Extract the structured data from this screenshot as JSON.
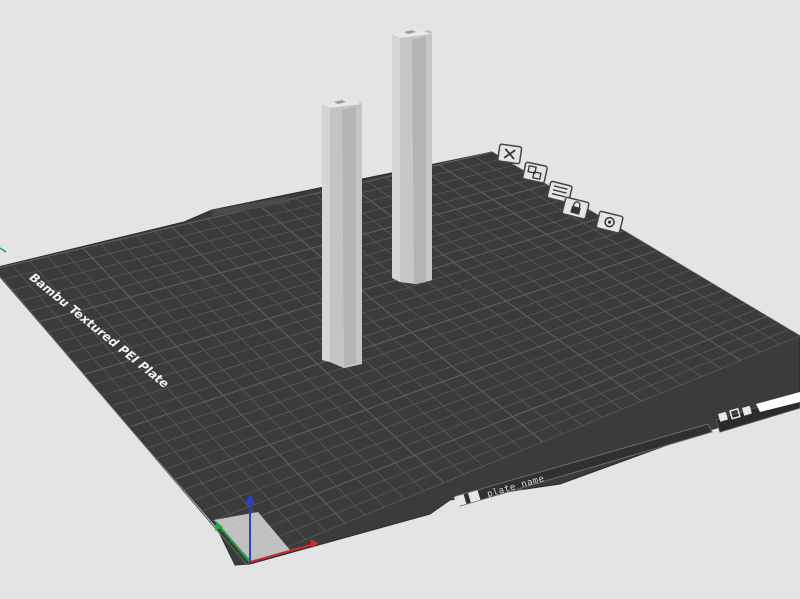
{
  "scene": {
    "bed_label": "Bambu Textured PEI Plate",
    "plate_name_field": "plate_name"
  },
  "plate_toolbar": [
    {
      "name": "delete-plate-icon",
      "icon": "close-icon"
    },
    {
      "name": "arrange-plate-icon",
      "icon": "arrange-icon"
    },
    {
      "name": "orient-plate-icon",
      "icon": "orient-icon"
    },
    {
      "name": "lock-plate-icon",
      "icon": "lock-icon"
    },
    {
      "name": "plate-settings-icon",
      "icon": "gear-icon"
    }
  ],
  "colors": {
    "background": "#e3e4e4",
    "bed": "#3a3b3b",
    "grid": "#5c5d5d",
    "object": "#c9c9c9",
    "axis_x": "#d12a2a",
    "axis_y": "#22a64a",
    "axis_z": "#2a3fd1"
  }
}
